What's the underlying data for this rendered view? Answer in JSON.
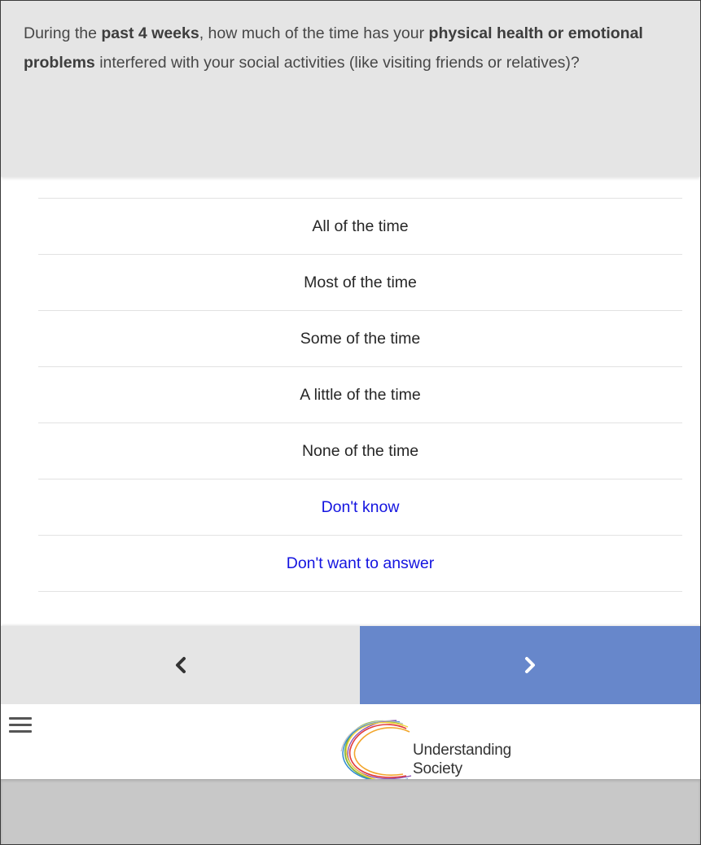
{
  "question": {
    "text_before_1": "During the ",
    "bold_1": "past 4 weeks",
    "text_middle": ", how much of the time has your ",
    "bold_2": "physical health or emotional problems",
    "text_after": " interfered with your social activities (like visiting friends or relatives)?"
  },
  "answers": [
    {
      "label": "All of the time"
    },
    {
      "label": "Most of the time"
    },
    {
      "label": "Some of the time"
    },
    {
      "label": "A little of the time"
    },
    {
      "label": "None of the time"
    },
    {
      "label": "Don't know"
    },
    {
      "label": "Don't want to answer"
    }
  ],
  "navigation": {
    "prev_icon": "chevron-left-icon",
    "next_icon": "chevron-right-icon"
  },
  "footer": {
    "menu_icon": "hamburger-menu-icon",
    "logo_line_1": "Understanding",
    "logo_line_2": "Society"
  },
  "colors": {
    "question_bg": "#e5e5e5",
    "next_button": "#6787cb",
    "prev_button": "#e5e5e5",
    "special_answer_text": "#1414e0",
    "answer_text": "#262626"
  }
}
